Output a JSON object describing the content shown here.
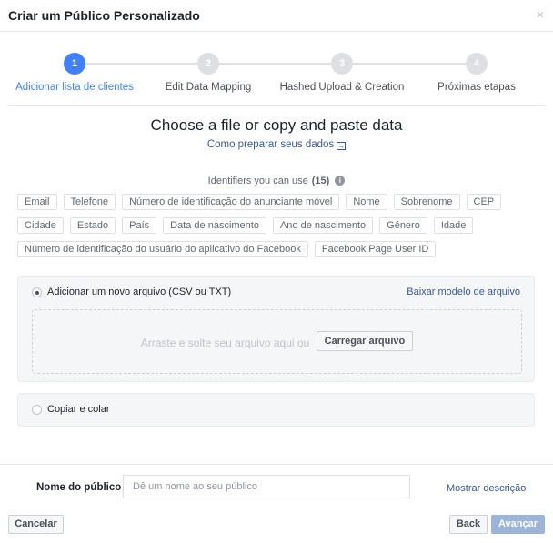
{
  "header": {
    "title": "Criar um Público Personalizado",
    "close_glyph": "×"
  },
  "steps": [
    {
      "number": "1",
      "label": "Adicionar lista de clientes",
      "active": true
    },
    {
      "number": "2",
      "label": "Edit Data Mapping",
      "active": false
    },
    {
      "number": "3",
      "label": "Hashed Upload & Creation",
      "active": false
    },
    {
      "number": "4",
      "label": "Próximas etapas",
      "active": false
    }
  ],
  "main": {
    "title": "Choose a file or copy and paste data",
    "prep_link": "Como preparar seus dados",
    "identifiers_label": "Identifiers you can use",
    "identifiers_count": "(15)",
    "info_glyph": "i"
  },
  "identifiers": [
    [
      "Email",
      "Telefone",
      "Número de identificação do anunciante móvel",
      "Nome",
      "Sobrenome",
      "CEP"
    ],
    [
      "Cidade",
      "Estado",
      "País",
      "Data de nascimento",
      "Ano de nascimento",
      "Gênero",
      "Idade"
    ],
    [
      "Número de identificação do usuário do aplicativo do Facebook",
      "Facebook Page User ID"
    ]
  ],
  "upload": {
    "option_label": "Adicionar um novo arquivo (CSV ou TXT)",
    "template_link": "Baixar modelo de arquivo",
    "drop_text": "Arraste e solte seu arquivo aqui ou",
    "upload_button": "Carregar arquivo",
    "selected": true
  },
  "paste": {
    "option_label": "Copiar e colar",
    "selected": false
  },
  "audience_name": {
    "label": "Nome do público",
    "placeholder": "Dê um nome ao seu público",
    "value": "",
    "description_link": "Mostrar descrição"
  },
  "footer": {
    "cancel": "Cancelar",
    "back": "Back",
    "next": "Avançar"
  },
  "colors": {
    "accent": "#4080ff",
    "link": "#365899",
    "disabled_button": "#9cb4d8"
  }
}
